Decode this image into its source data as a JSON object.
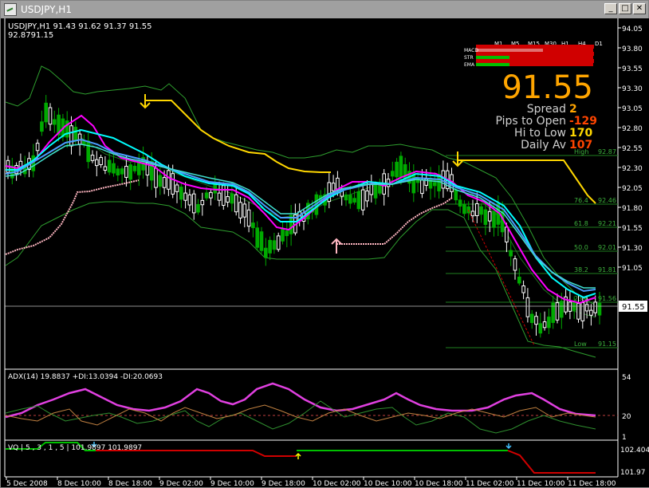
{
  "window": {
    "title": "USDJPY,H1",
    "min_glyph": "_",
    "max_glyph": "□",
    "close_glyph": "✕"
  },
  "main": {
    "header": "USDJPY,H1  91.43 91.62 91.37 91.55",
    "subheader": "92.8791.15",
    "yaxis_labels": [
      "94.05",
      "93.80",
      "93.55",
      "93.30",
      "93.05",
      "92.80",
      "92.55",
      "92.30",
      "92.05",
      "91.80",
      "91.55",
      "91.30",
      "91.05"
    ],
    "current_price_label": "91.55",
    "timeframes": [
      "M1",
      "M5",
      "M15",
      "M30",
      "H1",
      "H4",
      "D1"
    ],
    "indicator_rows": [
      "MACD",
      "STR",
      "EMA"
    ],
    "big_price": "91.55",
    "stats": [
      {
        "label": "Spread",
        "value": "2",
        "color": "#ffa500"
      },
      {
        "label": "Pips to Open",
        "value": "-129",
        "color": "#ff4500"
      },
      {
        "label": "Hi to Low",
        "value": "170",
        "color": "#ffd700"
      },
      {
        "label": "Daily Av",
        "value": "107",
        "color": "#ff4500"
      }
    ],
    "fib_levels": [
      {
        "label": "High",
        "value": "92.87"
      },
      {
        "label": "76.4",
        "value": "92.46"
      },
      {
        "label": "61.8",
        "value": "92.21"
      },
      {
        "label": "50.0",
        "value": "92.01"
      },
      {
        "label": "38.2",
        "value": "91.81"
      },
      {
        "label": "23.6",
        "value": "91.56"
      },
      {
        "label": "Low",
        "value": "91.15"
      }
    ]
  },
  "adx": {
    "header": "ADX(14) 19.8837 +DI:13.0394 -DI:20.0693",
    "yaxis_labels": [
      "54",
      "20",
      "1"
    ]
  },
  "vq": {
    "header": "VQ | 5 , 3 , 1 , 5 | 101.9897 101.9897",
    "yaxis_labels": [
      "102.4041",
      "101.97"
    ]
  },
  "xaxis_labels": [
    "5 Dec 2008",
    "8 Dec 10:00",
    "8 Dec 18:00",
    "9 Dec 02:00",
    "9 Dec 10:00",
    "9 Dec 18:00",
    "10 Dec 02:00",
    "10 Dec 10:00",
    "10 Dec 18:00",
    "11 Dec 02:00",
    "11 Dec 10:00",
    "11 Dec 18:00"
  ],
  "colors": {
    "background": "#000000",
    "bull_candle": "#ffffff",
    "bear_candle": "#00aa00",
    "bollinger": "#2e9e2e",
    "ma_magenta": "#ff00ff",
    "ma_cyan": "#00ffff",
    "ma_blue": "#4a9eff",
    "ma_teal": "#40e0d0",
    "resistance": "#ffd700",
    "support": "#ffb6c1",
    "adx": "#e040e0",
    "vq_up": "#00c000",
    "vq_down": "#d00000"
  }
}
